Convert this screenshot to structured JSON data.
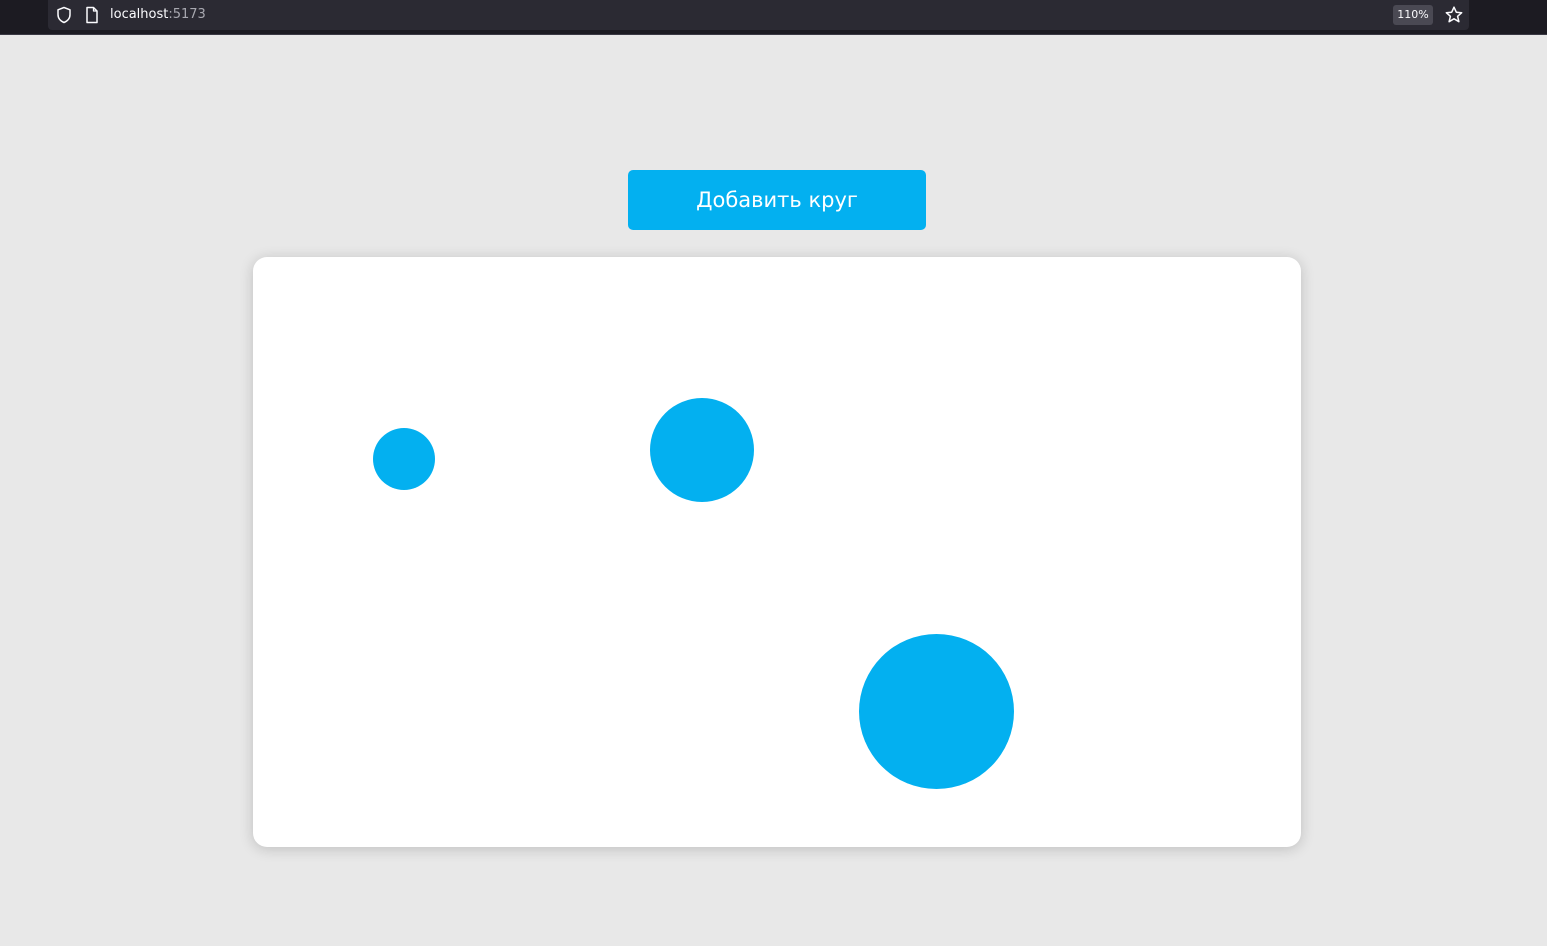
{
  "browser": {
    "url_host": "localhost",
    "url_port": ":5173",
    "zoom": "110%",
    "icons": [
      "shield-icon",
      "page-icon",
      "star-icon"
    ]
  },
  "toolbar": {
    "add_circle_label": "Добавить круг"
  },
  "canvas": {
    "circle_count": 3,
    "circle_color": "#03b0f0"
  },
  "colors": {
    "accent": "#03b0f0",
    "page_background": "#e8e8e8",
    "panel_background": "#ffffff",
    "browser_chrome": "#1c1b22"
  }
}
